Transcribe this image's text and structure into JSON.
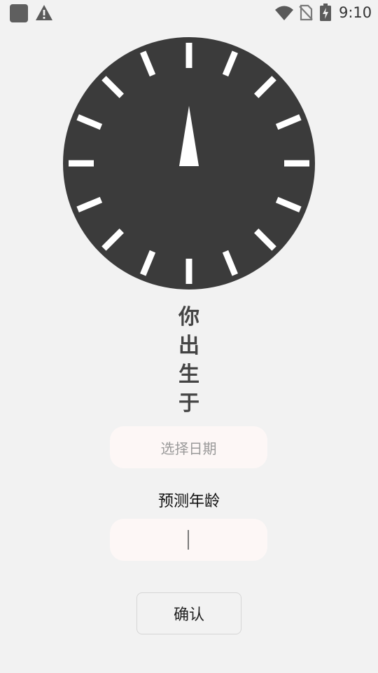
{
  "status_bar": {
    "time": "9:10"
  },
  "colors": {
    "background": "#f2f2f2",
    "dial_face": "#3b3b3b",
    "dial_marks": "#ffffff",
    "field_background": "#fdf7f6"
  },
  "icons": {
    "app": "app-square-icon",
    "alert": "warning-triangle-icon",
    "wifi": "wifi-icon",
    "sim": "no-sim-icon",
    "battery": "battery-charging-icon"
  },
  "title": {
    "chars": [
      "你",
      "出",
      "生",
      "于"
    ]
  },
  "date_picker": {
    "label": "选择日期"
  },
  "age": {
    "label": "预测年龄",
    "value": ""
  },
  "confirm": {
    "label": "确认"
  }
}
